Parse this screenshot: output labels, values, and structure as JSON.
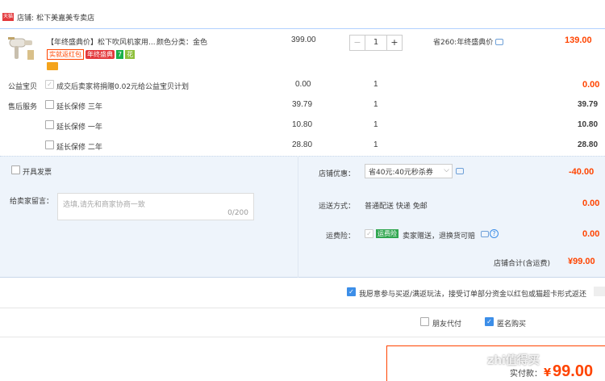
{
  "colors": {
    "accent": "#ff4400",
    "brand_red": "#e3393c",
    "panel_bg": "#eef4fb",
    "link_blue": "#3c8ee8"
  },
  "shop": {
    "badge": "天猫",
    "label": "店铺:",
    "name": "松下美嘉美专卖店"
  },
  "product": {
    "title": "【年终盛典价】松下吹风机家用...",
    "spec": "颜色分类：金色",
    "unit_price": "399.00",
    "quantity": "1",
    "minus": "−",
    "plus": "+",
    "discount": "省260:年终盛典价",
    "subtotal": "139.00",
    "tags": [
      "实就返红包",
      "年终盛典",
      "7",
      "花"
    ]
  },
  "charity": {
    "label": "公益宝贝",
    "text": "成交后卖家将捐赠0.02元给公益宝贝计划",
    "price": "0.00",
    "qty": "1",
    "total": "0.00"
  },
  "after_sales": {
    "label": "售后服务",
    "rows": [
      {
        "name": "延长保修 三年",
        "price": "39.79",
        "qty": "1",
        "total": "39.79"
      },
      {
        "name": "延长保修 一年",
        "price": "10.80",
        "qty": "1",
        "total": "10.80"
      },
      {
        "name": "延长保修 二年",
        "price": "28.80",
        "qty": "1",
        "total": "28.80"
      }
    ]
  },
  "invoice": {
    "label": "开具发票"
  },
  "message": {
    "label": "给卖家留言：",
    "placeholder": "选填,请先和商家协商一致",
    "counter": "0/200"
  },
  "shop_discount": {
    "label": "店铺优惠：",
    "value": "省40元:40元秒杀券",
    "amount": "-40.00"
  },
  "shipping": {
    "label": "运送方式：",
    "value": "普通配送 快递 免邮",
    "amount": "0.00"
  },
  "insurance": {
    "label": "运费险：",
    "badge": "运费险",
    "text": "卖家赠送，退换货可赔",
    "amount": "0.00"
  },
  "shop_total": {
    "label": "店铺合计(含运费)",
    "amount": "¥99.00"
  },
  "agreement": {
    "text": "我愿意参与买返/满返玩法，接受订单部分资金以红包或猫超卡形式返还"
  },
  "pay_options": {
    "friend_pay": "朋友代付",
    "anon": "匿名购买"
  },
  "final": {
    "label": "实付款：",
    "amount": "99.00",
    "currency": "¥"
  },
  "watermark": "zhi值得买"
}
